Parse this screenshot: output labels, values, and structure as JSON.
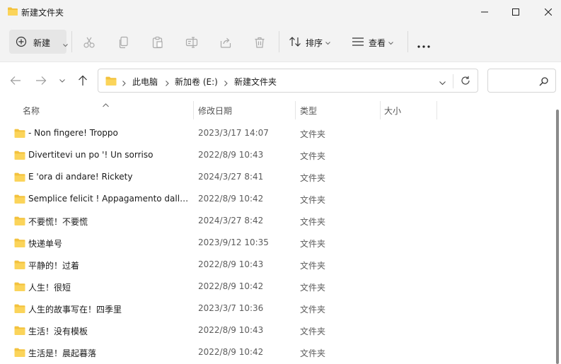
{
  "window": {
    "title": "新建文件夹",
    "buttons": [
      "minimize-button",
      "maximize-button",
      "close-button"
    ]
  },
  "toolbar": {
    "new_label": "新建",
    "sort_label": "排序",
    "view_label": "查看",
    "icons": [
      "cut-icon",
      "copy-icon",
      "paste-icon",
      "rename-icon",
      "share-icon",
      "delete-icon"
    ]
  },
  "address": {
    "crumbs": [
      "此电脑",
      "新加卷 (E:)",
      "新建文件夹"
    ]
  },
  "search": {
    "placeholder": ""
  },
  "columns": {
    "name": "名称",
    "date": "修改日期",
    "type": "类型",
    "size": "大小"
  },
  "files": [
    {
      "name": "- Non fingere! Troppo",
      "date": "2023/3/17 14:07",
      "type": "文件夹"
    },
    {
      "name": "Divertitevi un po '! Un sorriso",
      "date": "2022/8/9 10:43",
      "type": "文件夹"
    },
    {
      "name": "E 'ora di andare! Rickety",
      "date": "2024/3/27 8:41",
      "type": "文件夹"
    },
    {
      "name": "Semplice felicit ! Appagamento dallo...",
      "date": "2022/8/9 10:42",
      "type": "文件夹"
    },
    {
      "name": "不要慌！不要慌",
      "date": "2024/3/27 8:42",
      "type": "文件夹"
    },
    {
      "name": "快递单号",
      "date": "2023/9/12 10:35",
      "type": "文件夹"
    },
    {
      "name": "平静的！过着",
      "date": "2022/8/9 10:43",
      "type": "文件夹"
    },
    {
      "name": "人生！很短",
      "date": "2022/8/9 10:42",
      "type": "文件夹"
    },
    {
      "name": "人生的故事写在！四季里",
      "date": "2023/3/7 10:36",
      "type": "文件夹"
    },
    {
      "name": "生活！没有模板",
      "date": "2022/8/9 10:43",
      "type": "文件夹"
    },
    {
      "name": "生活是！晨起暮落",
      "date": "2022/8/9 10:42",
      "type": "文件夹"
    }
  ]
}
